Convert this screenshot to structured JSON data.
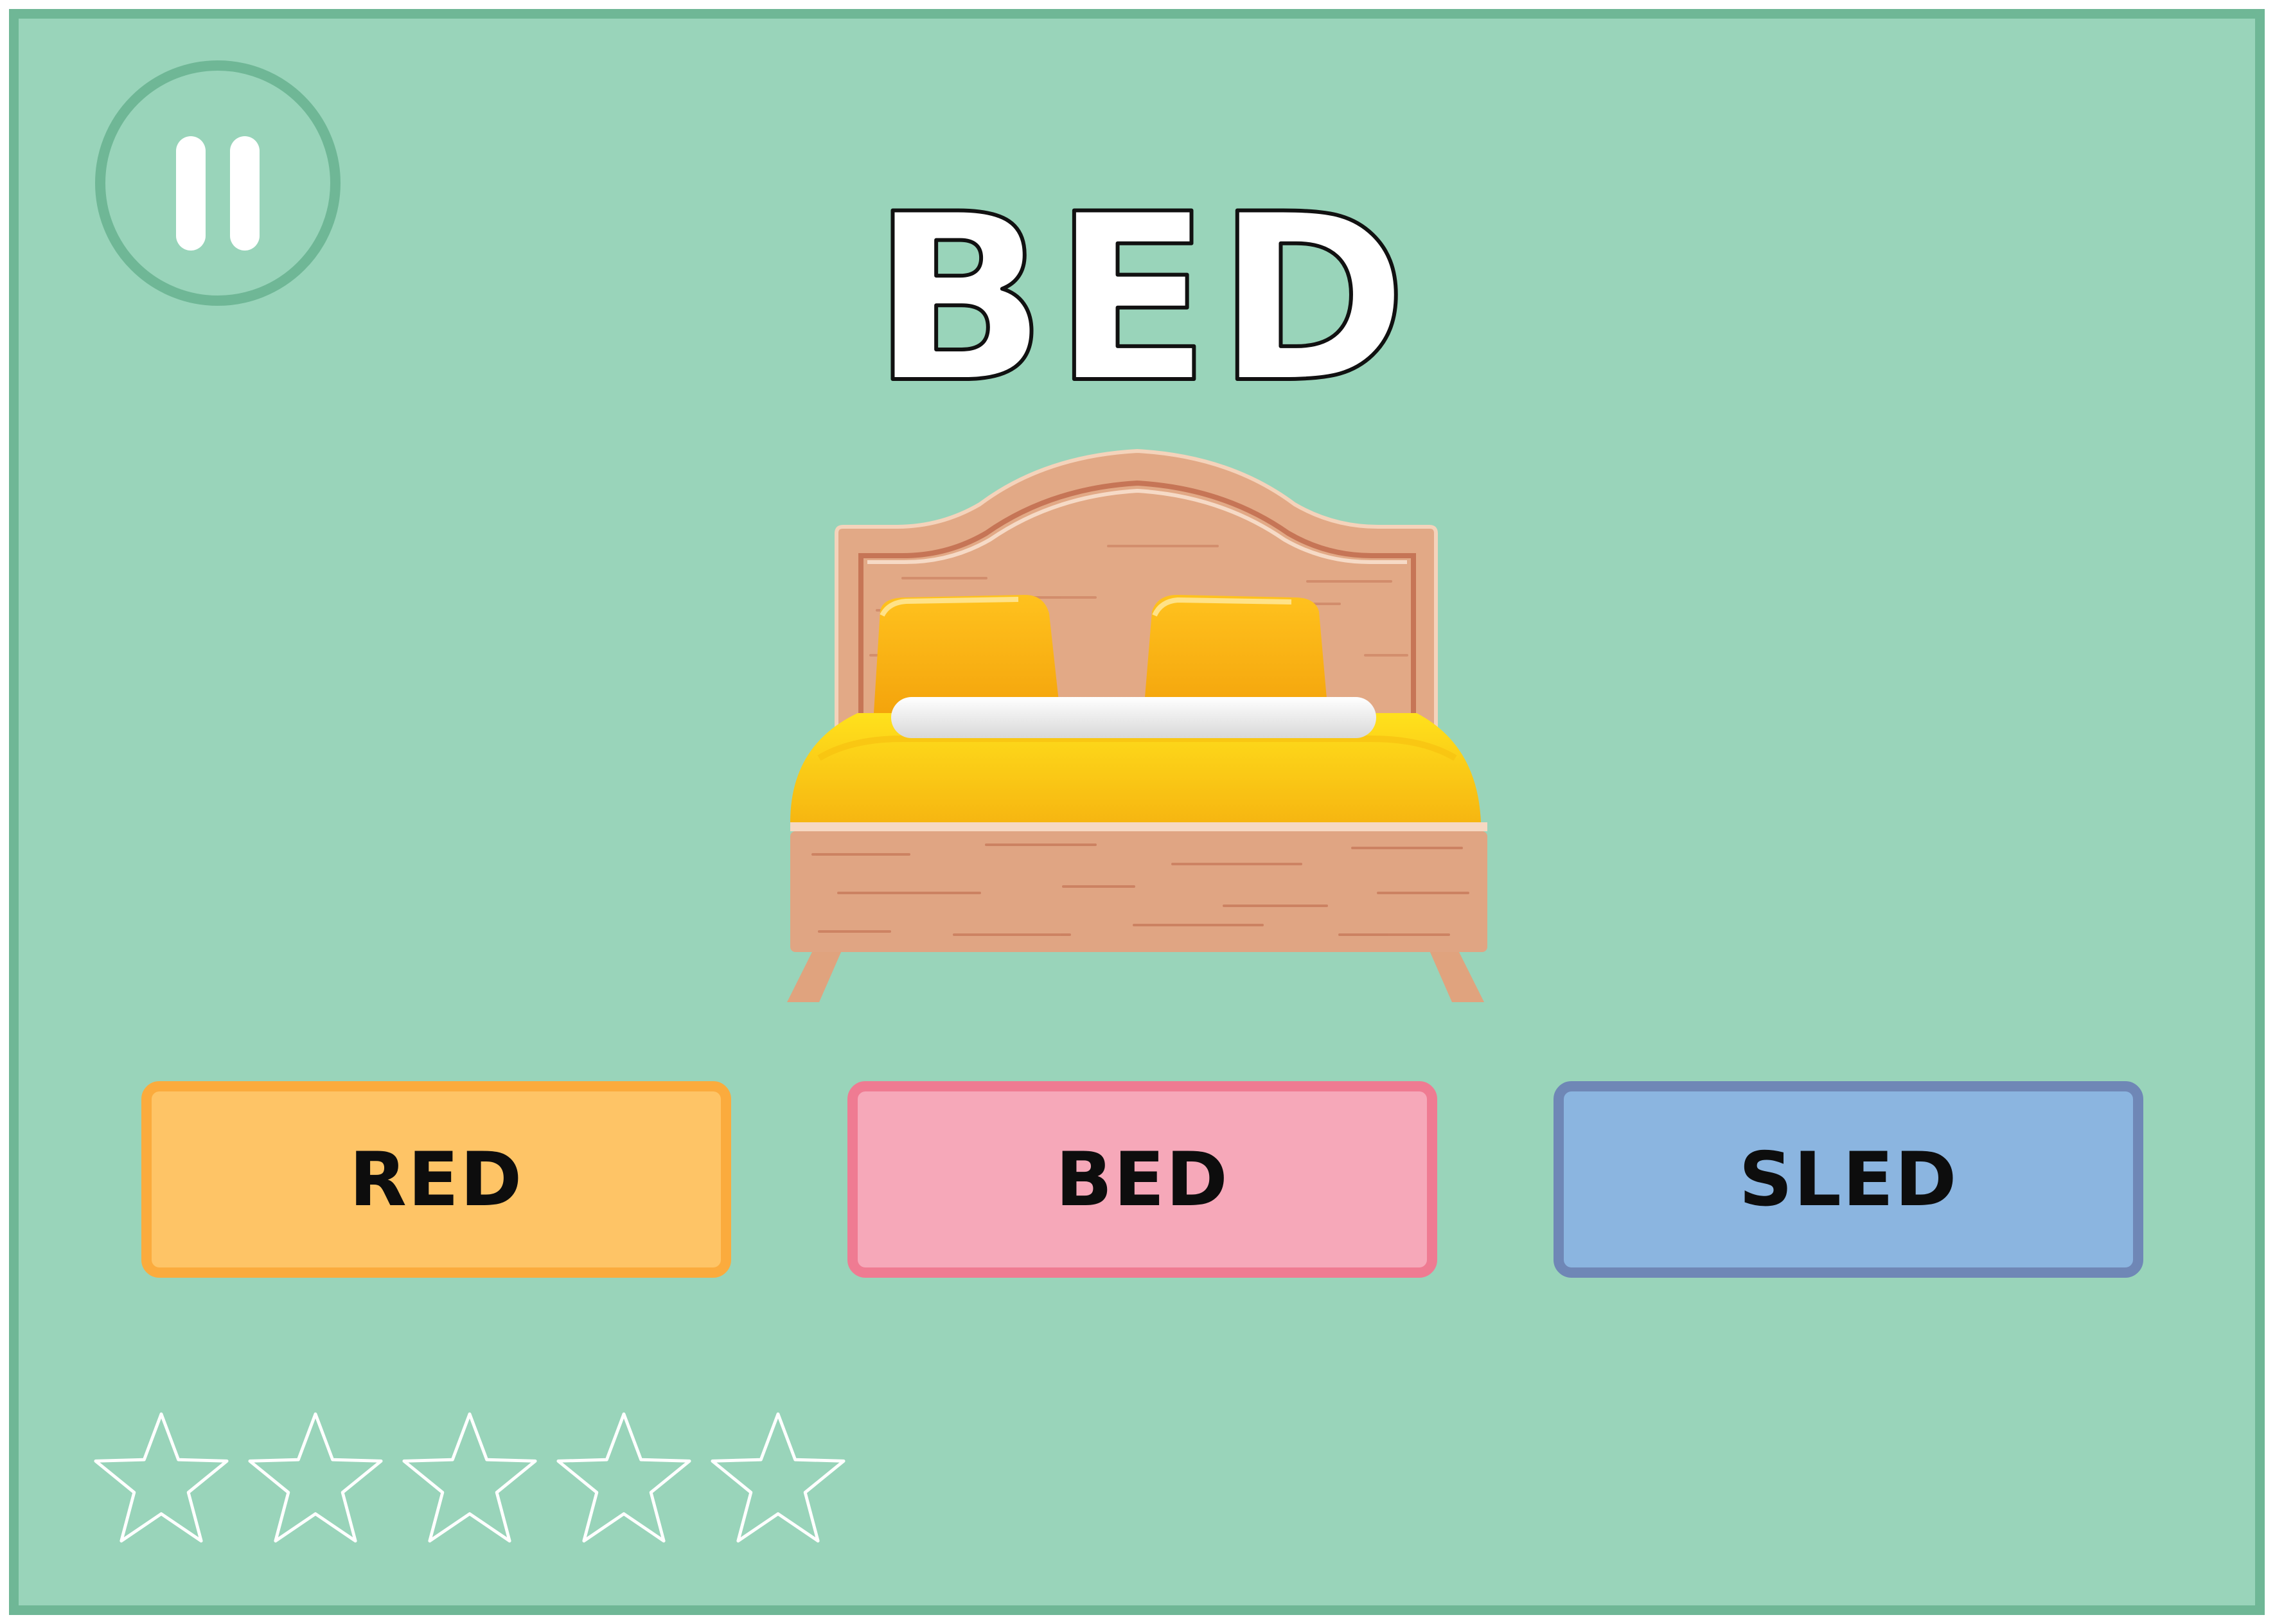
{
  "game": {
    "target_word": "BED",
    "choices": [
      {
        "label": "RED",
        "color": "#fec466",
        "border": "#fbab3d"
      },
      {
        "label": "BED",
        "color": "#f6a8b9",
        "border": "#ef7b92"
      },
      {
        "label": "SLED",
        "color": "#8bb5e0",
        "border": "#6f87b6"
      }
    ],
    "stars": {
      "earned": 0,
      "total": 5
    }
  },
  "controls": {
    "pause_icon": "pause-icon"
  },
  "picture": {
    "icon": "bed-icon"
  },
  "colors": {
    "background": "#99d4ba",
    "frame": "#6fb796",
    "title_fill": "#ffffff",
    "title_stroke": "#111111"
  }
}
